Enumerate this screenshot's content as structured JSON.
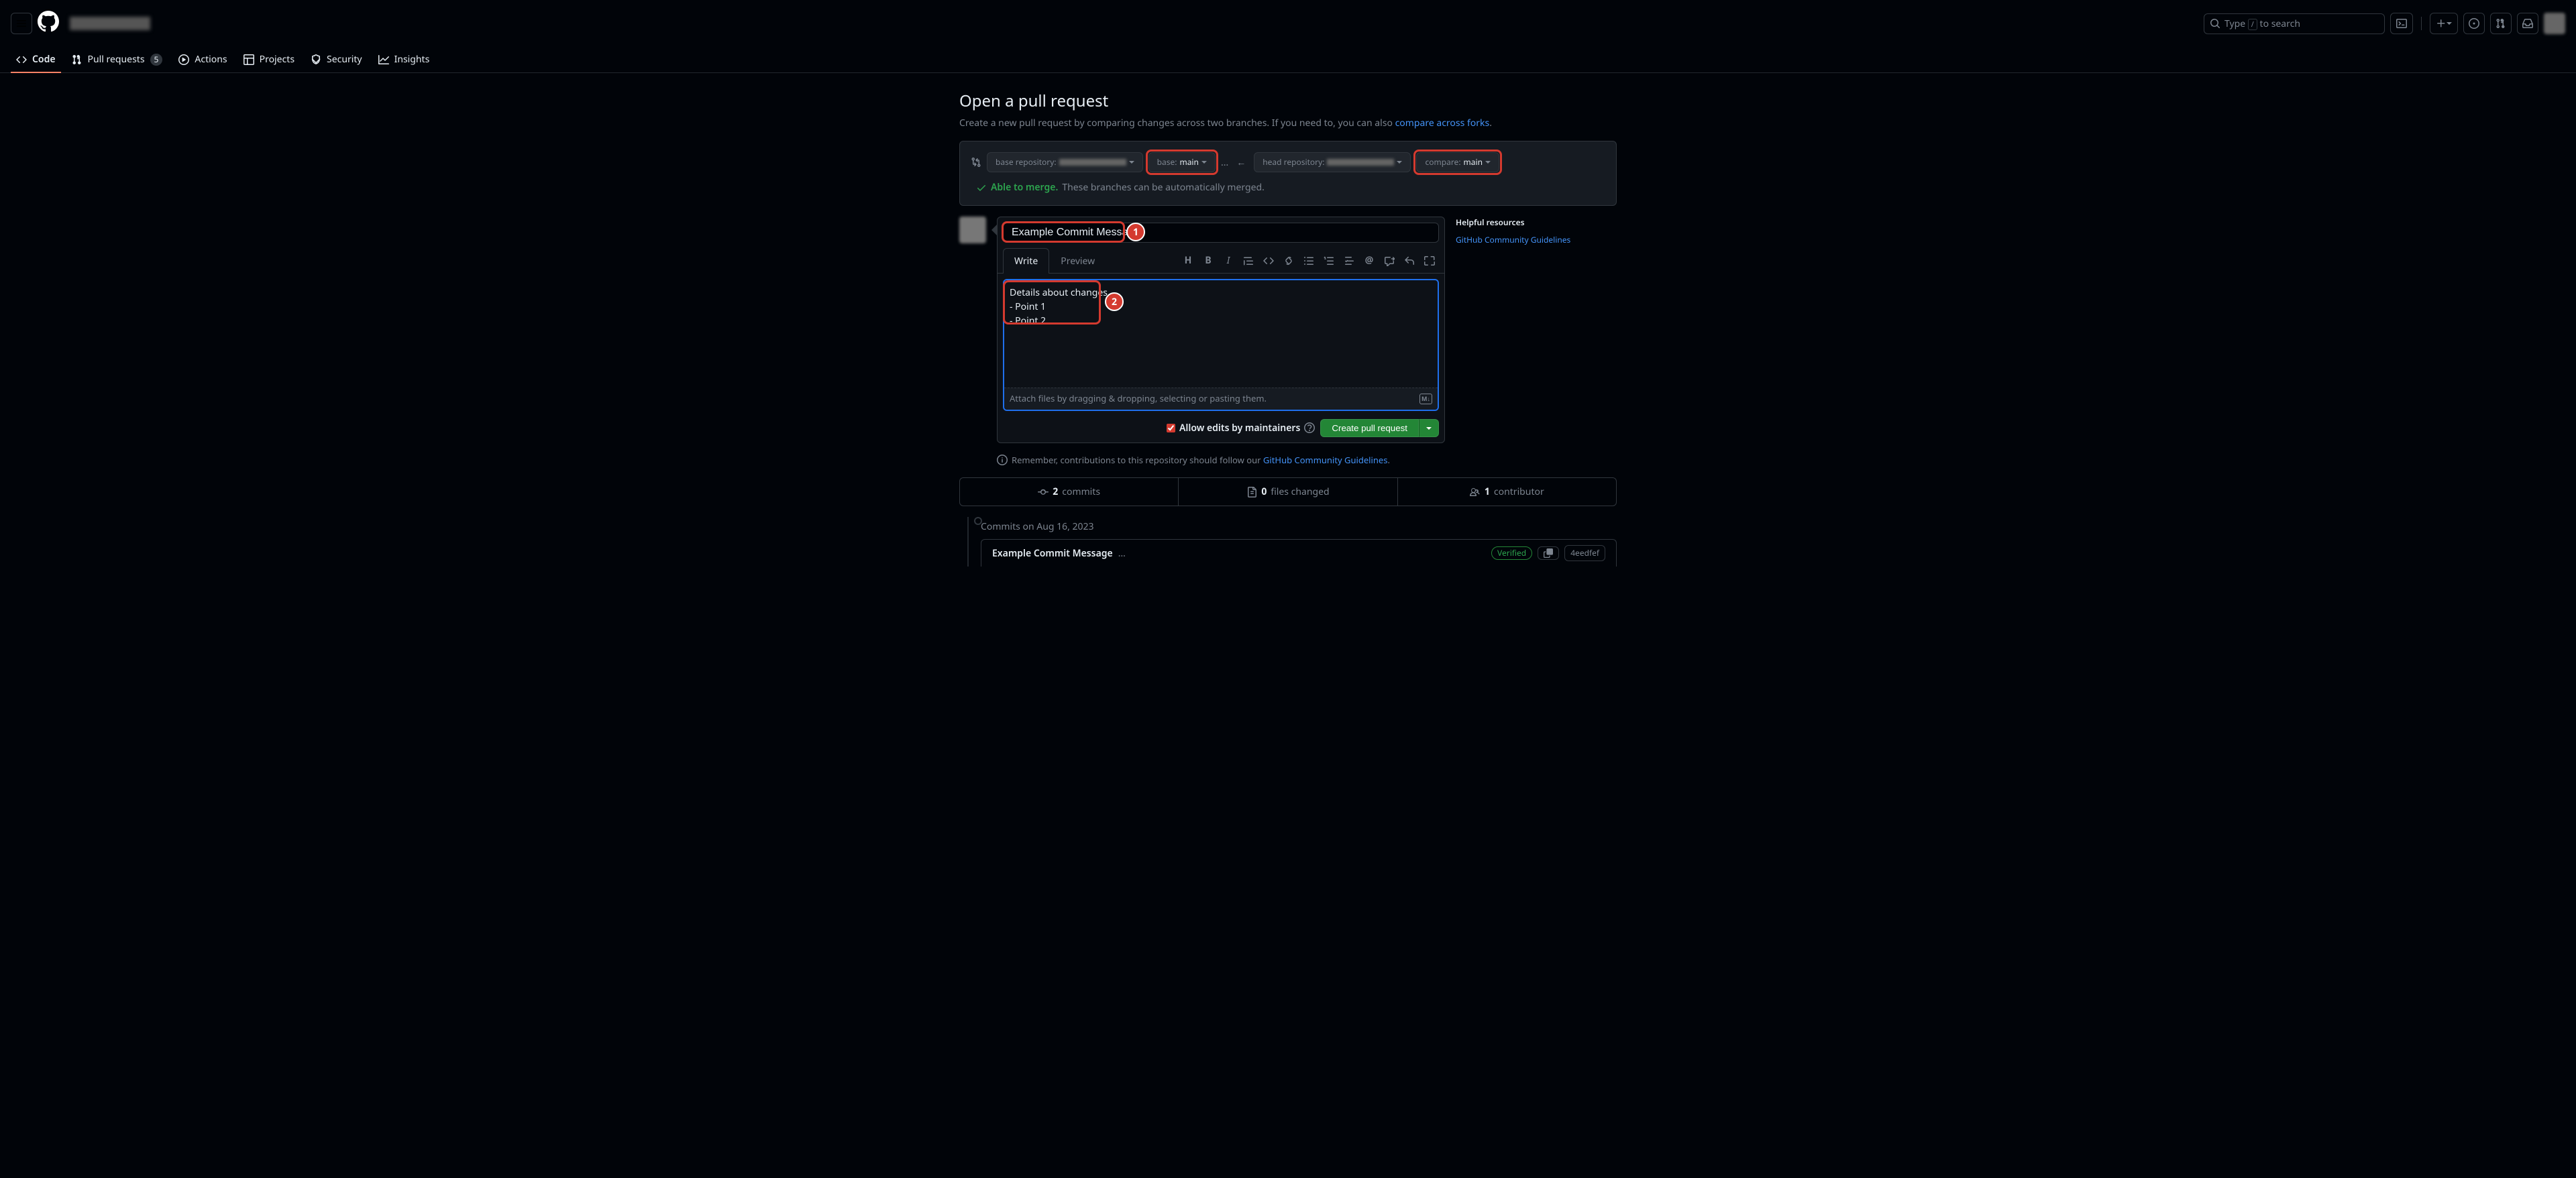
{
  "header": {
    "search_placeholder": "Type / to search",
    "search_key": "/"
  },
  "nav": {
    "code": "Code",
    "pull_requests": "Pull requests",
    "pr_count": "5",
    "actions": "Actions",
    "projects": "Projects",
    "security": "Security",
    "insights": "Insights"
  },
  "page": {
    "title": "Open a pull request",
    "subhead_pre": "Create a new pull request by comparing changes across two branches. If you need to, you can also ",
    "subhead_link": "compare across forks",
    "subhead_post": "."
  },
  "compare": {
    "base_repo_label": "base repository:",
    "base_branch_label": "base:",
    "base_branch_value": "main",
    "head_repo_label": "head repository:",
    "compare_branch_label": "compare:",
    "compare_branch_value": "main",
    "able": "Able to merge.",
    "able_msg": "These branches can be automatically merged."
  },
  "form": {
    "title_value": "Example Commit Message",
    "write_tab": "Write",
    "preview_tab": "Preview",
    "body_value": "Details about changes\n- Point 1\n- Point 2",
    "attach_hint": "Attach files by dragging & dropping, selecting or pasting them.",
    "allow_edits": "Allow edits by maintainers",
    "create_btn": "Create pull request",
    "badge1": "1",
    "badge2": "2"
  },
  "sidebar": {
    "heading": "Helpful resources",
    "link": "GitHub Community Guidelines"
  },
  "guidelines": {
    "pre": "Remember, contributions to this repository should follow our ",
    "link": "GitHub Community Guidelines",
    "post": "."
  },
  "stats": {
    "commits_n": "2",
    "commits_l": "commits",
    "files_n": "0",
    "files_l": "files changed",
    "contrib_n": "1",
    "contrib_l": "contributor"
  },
  "timeline": {
    "date": "Commits on Aug 16, 2023",
    "commit_msg": "Example Commit Message",
    "verified": "Verified",
    "sha": "4eedfef"
  }
}
